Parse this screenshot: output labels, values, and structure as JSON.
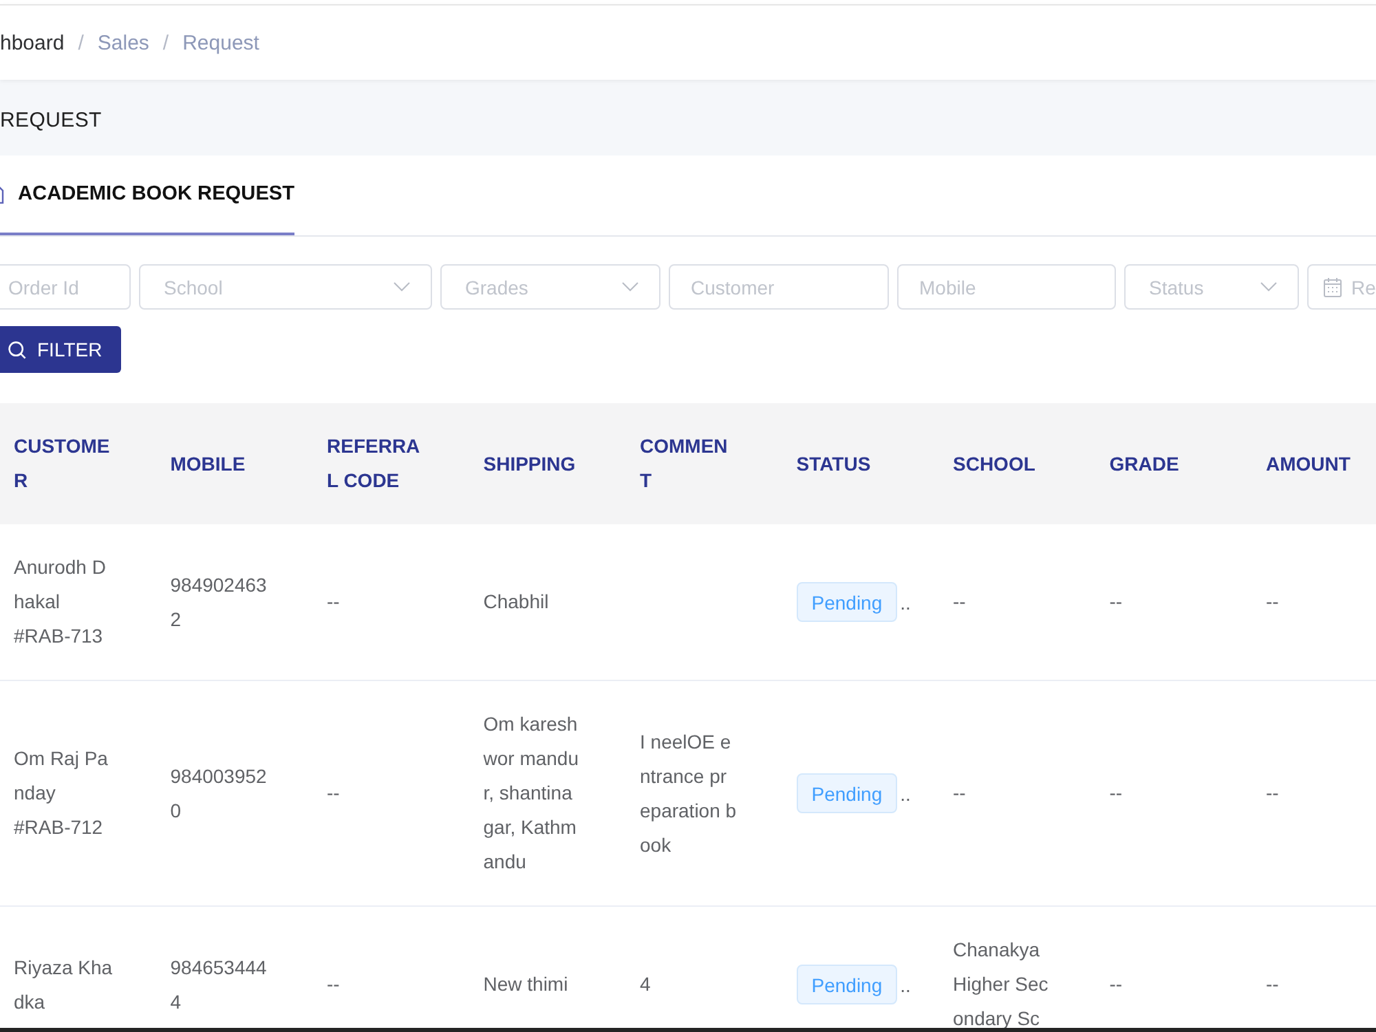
{
  "breadcrumb": [
    {
      "label": "hboard",
      "muted": false
    },
    {
      "separator": "/",
      "label": "Sales",
      "muted": true
    },
    {
      "separator": "/",
      "label": "Request",
      "muted": true
    }
  ],
  "page_title": "REQUEST",
  "tabs": [
    {
      "label": "ACADEMIC BOOK REQUEST",
      "selected": true
    }
  ],
  "filters": [
    {
      "kind": "text",
      "placeholder": "Order Id"
    },
    {
      "kind": "select",
      "placeholder": "School"
    },
    {
      "kind": "select",
      "placeholder": "Grades"
    },
    {
      "kind": "text",
      "placeholder": "Customer"
    },
    {
      "kind": "text",
      "placeholder": "Mobile"
    },
    {
      "kind": "select",
      "placeholder": "Status"
    },
    {
      "kind": "date",
      "placeholder": "Re"
    }
  ],
  "filter_button": {
    "label": "FILTER"
  },
  "table": {
    "columns": [
      "CUSTOMER",
      "MOBILE",
      "REFERRAL CODE",
      "SHIPPING",
      "COMMENT",
      "STATUS",
      "SCHOOL",
      "GRADE",
      "AMOUNT"
    ],
    "rows": [
      {
        "customer": "Anurodh Dhakal",
        "order_id": "#RAB-713",
        "mobile": "9849024632",
        "referral_code": "--",
        "shipping": "Chabhil",
        "status": "Pending",
        "status_suffix": "..",
        "school": "--",
        "grade": "--",
        "amount": "--"
      },
      {
        "customer": "Om Raj Panday",
        "order_id": "#RAB-712",
        "mobile": "9840039520",
        "referral_code": "--",
        "shipping": "Om kareshwor mandur, shantinagar, Kathmandu",
        "comment": "I neelOE entrance preparation book",
        "status": "Pending",
        "status_suffix": "..",
        "school": "--",
        "grade": "--",
        "amount": "--"
      },
      {
        "customer": "Riyaza Khadka",
        "mobile": "9846534444",
        "referral_code": "--",
        "shipping": "New thimi",
        "comment": "4",
        "status": "Pending",
        "status_suffix": "..",
        "school": "Chanakya Higher Secondary Sc",
        "grade": "--",
        "amount": "--"
      }
    ]
  }
}
